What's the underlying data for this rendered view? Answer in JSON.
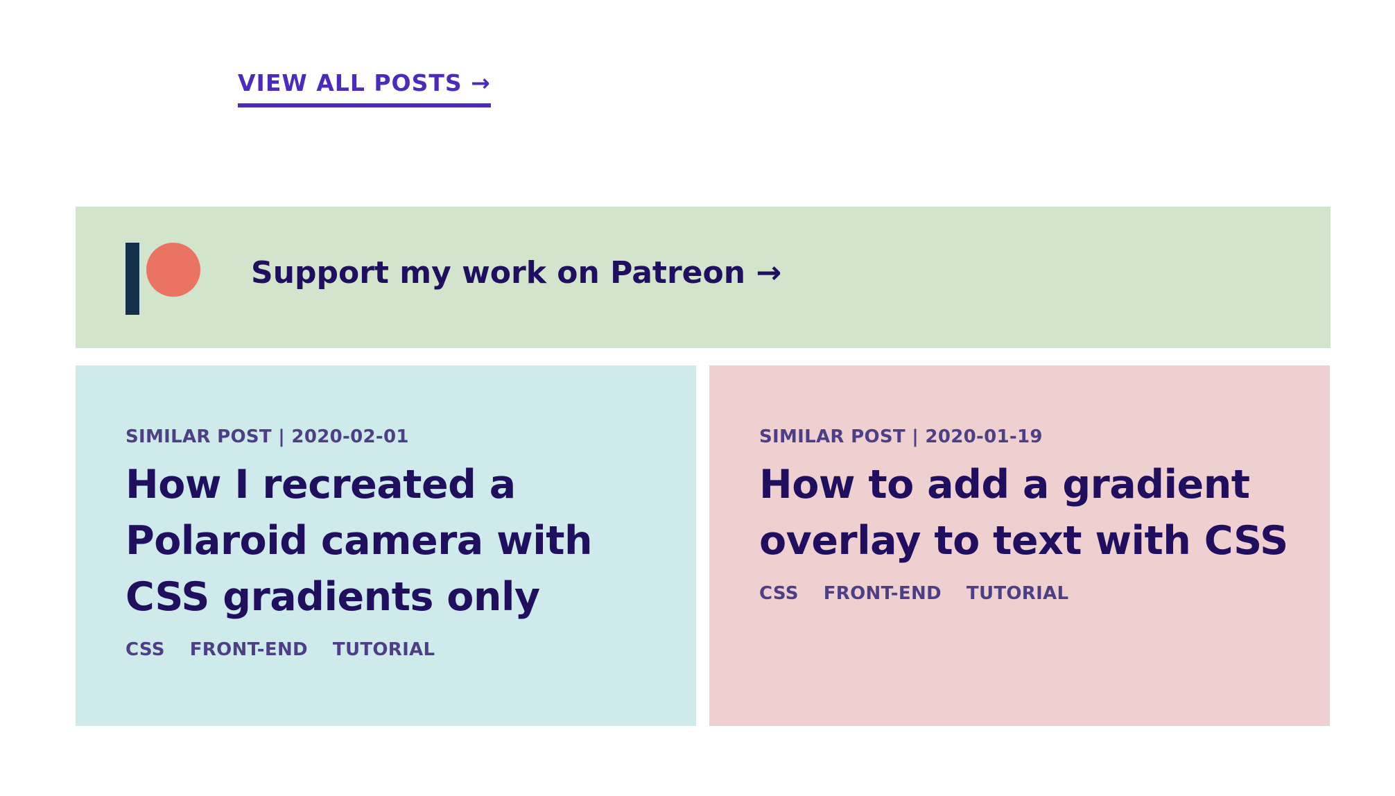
{
  "colors": {
    "accent": "#4b2bbe",
    "heading": "#1f0f5e",
    "meta_text": "#4c3f86",
    "patreon_background": "#d2e5cc",
    "patreon_logo_bar": "#13304a",
    "patreon_logo_dot": "#ea7363",
    "card_left_background": "#cfeaeb",
    "card_right_background": "#eed0d0"
  },
  "view_all": {
    "label": "VIEW ALL POSTS →"
  },
  "patreon": {
    "label": "Support my work on Patreon →",
    "icon": "patreon-logo-icon"
  },
  "similar_posts": [
    {
      "meta": "SIMILAR POST | 2020-02-01",
      "title": "How I recreated a Polaroid camera with CSS gradients only",
      "tags": [
        "CSS",
        "FRONT-END",
        "TUTORIAL"
      ]
    },
    {
      "meta": "SIMILAR POST | 2020-01-19",
      "title": "How to add a gradient overlay to text with CSS",
      "tags": [
        "CSS",
        "FRONT-END",
        "TUTORIAL"
      ]
    }
  ]
}
